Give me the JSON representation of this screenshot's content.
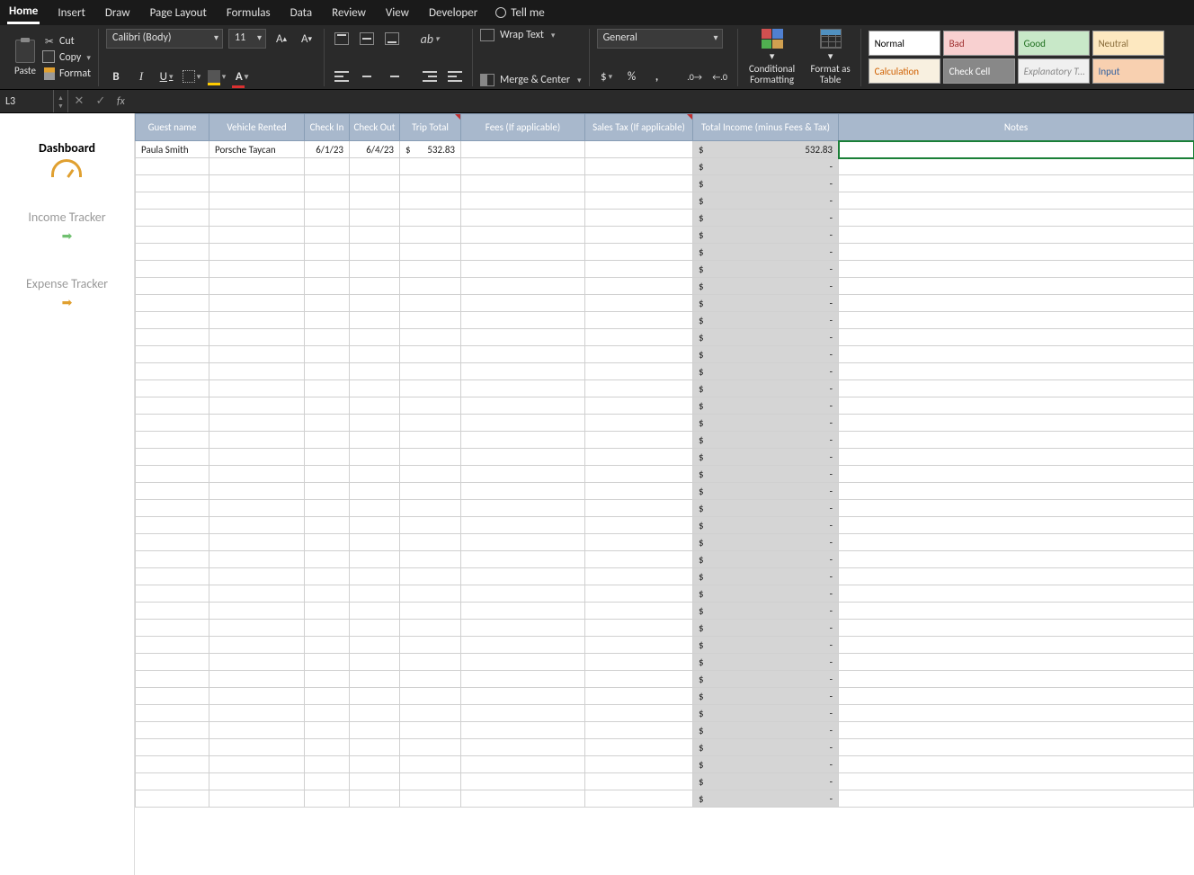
{
  "ribbon": {
    "tabs": [
      "Home",
      "Insert",
      "Draw",
      "Page Layout",
      "Formulas",
      "Data",
      "Review",
      "View",
      "Developer"
    ],
    "active_tab": "Home",
    "tell_me": "Tell me",
    "clipboard": {
      "paste": "Paste",
      "cut": "Cut",
      "copy": "Copy",
      "format": "Format"
    },
    "font": {
      "name": "Calibri (Body)",
      "size": "11"
    },
    "alignment": {
      "wrap": "Wrap Text",
      "merge": "Merge & Center"
    },
    "number": {
      "format": "General"
    },
    "styles": {
      "cond": "Conditional Formatting",
      "table": "Format as Table",
      "cells": [
        {
          "label": "Normal",
          "bg": "#ffffff",
          "color": "#000"
        },
        {
          "label": "Bad",
          "bg": "#f8d0d0",
          "color": "#a03030"
        },
        {
          "label": "Good",
          "bg": "#c8e8c8",
          "color": "#207020"
        },
        {
          "label": "Neutral",
          "bg": "#fde8c0",
          "color": "#8a6d3b"
        },
        {
          "label": "Calculation",
          "bg": "#f8f0e0",
          "color": "#d06000"
        },
        {
          "label": "Check Cell",
          "bg": "#888888",
          "color": "#fff"
        },
        {
          "label": "Explanatory T...",
          "bg": "#f0f0f0",
          "color": "#888",
          "italic": true
        },
        {
          "label": "Input",
          "bg": "#f8d0b0",
          "color": "#3060a0"
        }
      ]
    }
  },
  "namebox": "L3",
  "formula": "",
  "sheet_nav": [
    {
      "label": "Dashboard",
      "active": true,
      "icon": "dash"
    },
    {
      "label": "Income Tracker",
      "active": false,
      "icon": "arrow-green"
    },
    {
      "label": "Expense Tracker",
      "active": false,
      "icon": "arrow-orange"
    }
  ],
  "headers": [
    "Guest name",
    "Vehicle Rented",
    "Check In",
    "Check Out",
    "Trip Total",
    "Fees (If applicable)",
    "Sales Tax (If applicable)",
    "Total Income (minus Fees & Tax)",
    "Notes"
  ],
  "header_marks": [
    false,
    false,
    false,
    false,
    true,
    false,
    true,
    false,
    false
  ],
  "rows": [
    {
      "guest": "Paula Smith",
      "vehicle": "Porsche Taycan",
      "checkin": "6/1/23",
      "checkout": "6/4/23",
      "trip": "532.83",
      "fees": "",
      "tax": "",
      "total": "532.83",
      "notes": ""
    }
  ],
  "empty_row_count": 38,
  "empty_total_display": "-",
  "currency_symbol": "$",
  "selected_cell": {
    "row": 0,
    "col": "notes"
  }
}
